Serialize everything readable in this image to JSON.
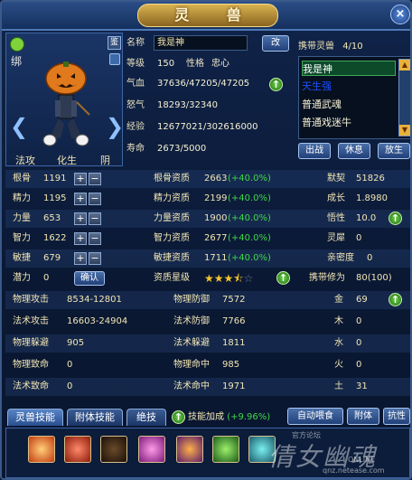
{
  "window": {
    "title": "灵 兽",
    "close": "×"
  },
  "portrait": {
    "bind": "绑",
    "appraise": "鉴",
    "tabs": [
      "法攻",
      "化生",
      "阴"
    ]
  },
  "info": {
    "name_label": "名称",
    "name_value": "我是神",
    "rename_button": "改",
    "level_label": "等级",
    "level_value": "150",
    "temper_label": "性格",
    "temper_value": "忠心",
    "hp_label": "气血",
    "hp_value": "37636/47205/47205",
    "rage_label": "怒气",
    "rage_value": "18293/32340",
    "exp_label": "经验",
    "exp_value": "12677021/302616000",
    "life_label": "寿命",
    "life_value": "2673/5000"
  },
  "carry": {
    "label": "携带灵兽",
    "count": "4/10",
    "items": [
      "我是神",
      "天生强",
      "普通武魂",
      "普通戏迷牛"
    ],
    "buttons": [
      "出战",
      "休息",
      "放生"
    ]
  },
  "stats": {
    "rows": [
      {
        "a_label": "根骨",
        "a_value": "1191",
        "b_label": "根骨资质",
        "b_value": "2663",
        "b_bonus": "(+40.0%)",
        "c_label": "默契",
        "c_value": "51826"
      },
      {
        "a_label": "精力",
        "a_value": "1195",
        "b_label": "精力资质",
        "b_value": "2199",
        "b_bonus": "(+40.0%)",
        "c_label": "成长",
        "c_value": "1.8980"
      },
      {
        "a_label": "力量",
        "a_value": "653",
        "b_label": "力量资质",
        "b_value": "1900",
        "b_bonus": "(+40.0%)",
        "c_label": "悟性",
        "c_value": "10.0"
      },
      {
        "a_label": "智力",
        "a_value": "1622",
        "b_label": "智力资质",
        "b_value": "2677",
        "b_bonus": "(+40.0%)",
        "c_label": "灵犀",
        "c_value": "0"
      },
      {
        "a_label": "敏捷",
        "a_value": "679",
        "b_label": "敏捷资质",
        "b_value": "1711",
        "b_bonus": "(+40.0%)",
        "c_label": "亲密度",
        "c_value": "0"
      }
    ],
    "potential_label": "潜力",
    "potential_value": "0",
    "confirm_button": "确认",
    "aptitude_star_label": "资质星级",
    "aptitude_stars": 3.5,
    "carry_cultivation_label": "携带修为",
    "carry_cultivation_value": "80(100)",
    "combat": [
      {
        "l1": "物理攻击",
        "v1": "8534-12801",
        "l2": "物理防御",
        "v2": "7572",
        "l3": "金",
        "v3": "69"
      },
      {
        "l1": "法术攻击",
        "v1": "16603-24904",
        "l2": "法术防御",
        "v2": "7766",
        "l3": "木",
        "v3": "0"
      },
      {
        "l1": "物理躲避",
        "v1": "905",
        "l2": "法术躲避",
        "v2": "1811",
        "l3": "水",
        "v3": "0"
      },
      {
        "l1": "物理致命",
        "v1": "0",
        "l2": "物理命中",
        "v2": "985",
        "l3": "火",
        "v3": "0"
      },
      {
        "l1": "法术致命",
        "v1": "0",
        "l2": "法术命中",
        "v2": "1971",
        "l3": "土",
        "v3": "31"
      }
    ]
  },
  "bottom": {
    "tabs": [
      "灵兽技能",
      "附体技能",
      "绝技"
    ],
    "skill_bonus_label": "技能加成",
    "skill_bonus_value": "(+9.96%)",
    "feed_button": "自动喂食",
    "attach_button": "附体",
    "resist_button": "抗性",
    "watermark": "倩女幽魂",
    "wm_top": "官方论坛",
    "wm_site": "qnz.netease.com",
    "wm_online": "ONLINE"
  },
  "colors": {
    "accent_green": "#3fd64a",
    "title_gold": "#d9b350",
    "selected_blue": "#1e50ff"
  }
}
